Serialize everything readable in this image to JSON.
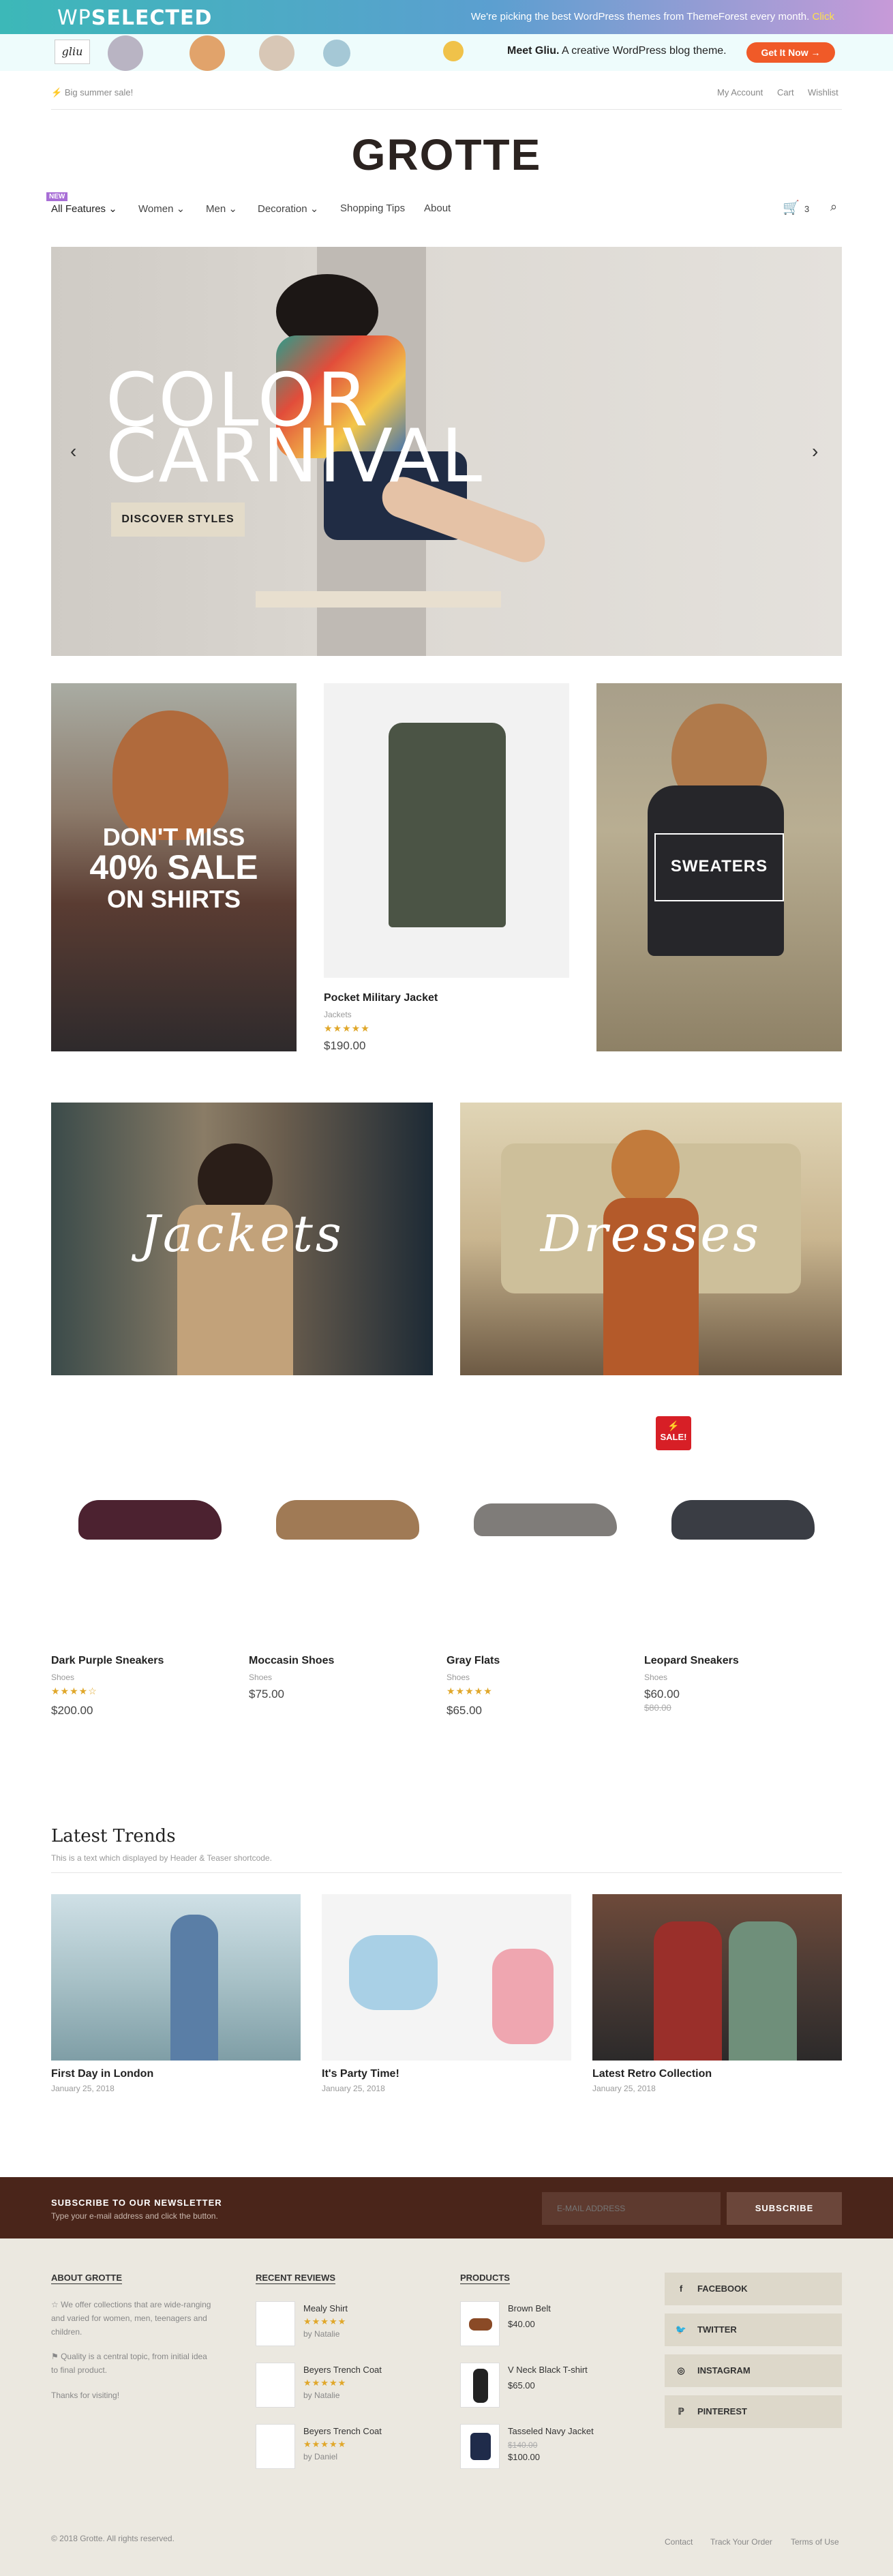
{
  "topbar": {
    "logo_a": "WP",
    "logo_b": "SELECTED",
    "message": "We're picking the best WordPress themes from ThemeForest every month.",
    "click": "Click"
  },
  "ad": {
    "gliu": "gliu",
    "meet_bold": "Meet Gliu.",
    "meet_rest": " A creative WordPress blog theme.",
    "button": "Get It Now →"
  },
  "util": {
    "promo": "Big summer sale!",
    "my_account": "My Account",
    "cart": "Cart",
    "wishlist": "Wishlist"
  },
  "brand": "GROTTE",
  "nav": {
    "badge": "NEW",
    "items": [
      "All Features",
      "Women",
      "Men",
      "Decoration",
      "Shopping Tips",
      "About"
    ],
    "cart_count": "3"
  },
  "hero": {
    "line1": "COLOR",
    "line2": "CARNIVAL",
    "button": "DISCOVER STYLES"
  },
  "promos": {
    "sale_line1": "DON'T MISS",
    "sale_line2": "40% SALE",
    "sale_line3": "ON SHIRTS",
    "sweaters": "SWEATERS"
  },
  "featured": {
    "name": "Pocket Military Jacket",
    "category": "Jackets",
    "stars": "★★★★★",
    "price": "$190.00"
  },
  "categories": {
    "jackets": "Jackets",
    "dresses": "Dresses"
  },
  "sale_badge": "SALE!",
  "products": [
    {
      "name": "Dark Purple Sneakers",
      "category": "Shoes",
      "stars": "★★★★☆",
      "price": "$200.00"
    },
    {
      "name": "Moccasin Shoes",
      "category": "Shoes",
      "stars": "",
      "price": "$75.00"
    },
    {
      "name": "Gray Flats",
      "category": "Shoes",
      "stars": "★★★★★",
      "price": "$65.00"
    },
    {
      "name": "Leopard Sneakers",
      "category": "Shoes",
      "stars": "",
      "price": "$60.00",
      "old_price": "$80.00"
    }
  ],
  "trends": {
    "title": "Latest Trends",
    "subtitle": "This is a text which displayed by Header & Teaser shortcode.",
    "posts": [
      {
        "title": "First Day in London",
        "date": "January 25, 2018"
      },
      {
        "title": "It's Party Time!",
        "date": "January 25, 2018"
      },
      {
        "title": "Latest Retro Collection",
        "date": "January 25, 2018"
      }
    ]
  },
  "newsletter": {
    "title": "SUBSCRIBE TO OUR NEWSLETTER",
    "subtitle": "Type your e-mail address and click the button.",
    "placeholder": "E-MAIL ADDRESS",
    "button": "SUBSCRIBE"
  },
  "footer": {
    "about": {
      "heading": "ABOUT GROTTE",
      "p1": "We offer collections that are wide-ranging and varied for women, men, teenagers and children.",
      "p2": "Quality is a central topic, from initial idea to final product.",
      "p3": "Thanks for visiting!"
    },
    "reviews": {
      "heading": "RECENT REVIEWS",
      "items": [
        {
          "name": "Mealy Shirt",
          "stars": "★★★★★",
          "by": "by Natalie"
        },
        {
          "name": "Beyers Trench Coat",
          "stars": "★★★★★",
          "by": "by Natalie"
        },
        {
          "name": "Beyers Trench Coat",
          "stars": "★★★★★",
          "by": "by Daniel"
        }
      ]
    },
    "products": {
      "heading": "PRODUCTS",
      "items": [
        {
          "name": "Brown Belt",
          "price": "$40.00"
        },
        {
          "name": "V Neck Black T-shirt",
          "price": "$65.00"
        },
        {
          "name": "Tasseled Navy Jacket",
          "old_price": "$140.00",
          "price": "$100.00"
        }
      ]
    },
    "social": [
      "FACEBOOK",
      "TWITTER",
      "INSTAGRAM",
      "PINTEREST"
    ],
    "copyright": "© 2018 Grotte. All rights reserved.",
    "links": [
      "Contact",
      "Track Your Order",
      "Terms of Use"
    ]
  }
}
